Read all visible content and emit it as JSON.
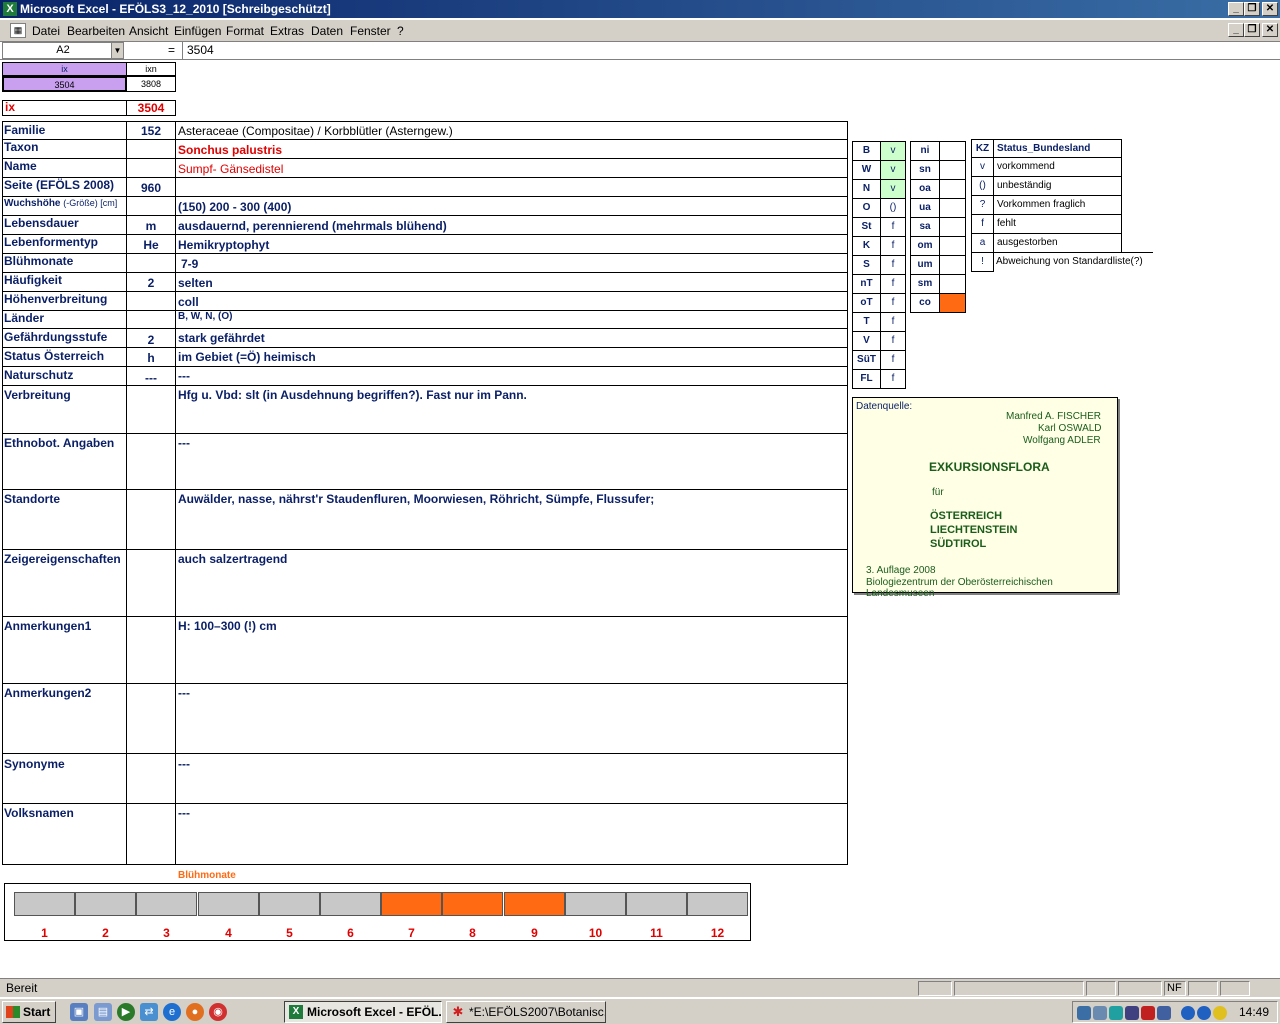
{
  "window": {
    "title": "Microsoft Excel - EFÖLS3_12_2010  [Schreibgeschützt]",
    "app_icon": "excel-icon"
  },
  "menu": [
    "Datei",
    "Bearbeiten",
    "Ansicht",
    "Einfügen",
    "Format",
    "Extras",
    "Daten",
    "Fenster",
    "?"
  ],
  "formula_bar": {
    "name_box": "A2",
    "equals": "=",
    "value": "3504"
  },
  "index_box": {
    "ix_label": "ix",
    "ixn_label": "ixn",
    "ix_value": "3504",
    "ixn_value": "3808"
  },
  "ix_row": {
    "label": "ix",
    "value": "3504"
  },
  "rows": [
    {
      "label": "Familie",
      "num": "152",
      "value": "Asteraceae (Compositae)  /  Korbblütler (Asterngew.)"
    },
    {
      "label": "Taxon",
      "num": "",
      "value": "Sonchus palustris"
    },
    {
      "label": "Name",
      "num": "",
      "value": "Sumpf- Gänsedistel"
    },
    {
      "label": "Seite (EFÖLS 2008)",
      "num": "960",
      "value": ""
    },
    {
      "label": "Wuchshöhe",
      "label_small": "(-Größe) [cm]",
      "num": "",
      "value": "(150) 200 - 300 (400)"
    },
    {
      "label": "Lebensdauer",
      "num": "m",
      "value": "ausdauernd, perennierend (mehrmals blühend)"
    },
    {
      "label": "Lebenformentyp",
      "num": "He",
      "value": "Hemikryptophyt"
    },
    {
      "label": "Blühmonate",
      "num": "",
      "value": "7-9"
    },
    {
      "label": "Häufigkeit",
      "num": "2",
      "value": "selten"
    },
    {
      "label": "Höhenverbreitung",
      "num": "",
      "value": "coll"
    },
    {
      "label": "Länder",
      "num": "",
      "value": "B, W, N, (O)"
    },
    {
      "label": "Gefährdungsstufe",
      "num": "2",
      "value": "stark gefährdet"
    },
    {
      "label": "Status Österreich",
      "num": "h",
      "value": "im Gebiet (=Ö) heimisch"
    },
    {
      "label": "Naturschutz",
      "num": "---",
      "value": "---"
    },
    {
      "label": "Verbreitung",
      "num": "",
      "value": "Hfg u. Vbd:  slt (in Ausdehnung begriffen?). Fast nur im Pann."
    },
    {
      "label": "Ethnobot. Angaben",
      "num": "",
      "value": "---"
    },
    {
      "label": "Standorte",
      "num": "",
      "value": "Auwälder, nasse, nährst'r Staudenfluren, Moorwiesen, Röhricht, Sümpfe, Flussufer;"
    },
    {
      "label": "Zeigereigenschaften",
      "num": "",
      "value": "auch salzertragend"
    },
    {
      "label": "Anmerkungen1",
      "num": "",
      "value": "H: 100–300 (!) cm"
    },
    {
      "label": "Anmerkungen2",
      "num": "",
      "value": "---"
    },
    {
      "label": "Synonyme",
      "num": "",
      "value": "---"
    },
    {
      "label": "Volksnamen",
      "num": "",
      "value": "---"
    }
  ],
  "laender_grid": [
    {
      "code": "B",
      "status": "v"
    },
    {
      "code": "W",
      "status": "v"
    },
    {
      "code": "N",
      "status": "v"
    },
    {
      "code": "O",
      "status": "()"
    },
    {
      "code": "St",
      "status": "f"
    },
    {
      "code": "K",
      "status": "f"
    },
    {
      "code": "S",
      "status": "f"
    },
    {
      "code": "nT",
      "status": "f"
    },
    {
      "code": "oT",
      "status": "f"
    },
    {
      "code": "T",
      "status": "f"
    },
    {
      "code": "V",
      "status": "f"
    },
    {
      "code": "SüT",
      "status": "f"
    },
    {
      "code": "FL",
      "status": "f"
    }
  ],
  "hoehen_grid": [
    "ni",
    "sn",
    "oa",
    "ua",
    "sa",
    "om",
    "um",
    "sm",
    "co"
  ],
  "hoehen_active": "co",
  "legend": {
    "header_kz": "KZ",
    "header_status": "Status_Bundesland",
    "items": [
      {
        "kz": "v",
        "text": "vorkommend"
      },
      {
        "kz": "()",
        "text": "unbeständig"
      },
      {
        "kz": "?",
        "text": "Vorkommen fraglich"
      },
      {
        "kz": "f",
        "text": "fehlt"
      },
      {
        "kz": "a",
        "text": "ausgestorben"
      },
      {
        "kz": "!",
        "text": "Abweichung von Standardliste(?)"
      }
    ]
  },
  "datenquelle": {
    "title": "Datenquelle:",
    "author1": "Manfred A. FISCHER",
    "author2": "Karl OSWALD",
    "author3": "Wolfgang ADLER",
    "book": "EXKURSIONSFLORA",
    "fuer": "für",
    "country1": "ÖSTERREICH",
    "country2": "LIECHTENSTEIN",
    "country3": "SÜDTIROL",
    "edition": "3. Auflage 2008",
    "publisher": "Biologiezentrum der Oberösterreichischen Landesmuseen"
  },
  "bluehmonate_chart": {
    "title": "Blühmonate",
    "months": [
      "1",
      "2",
      "3",
      "4",
      "5",
      "6",
      "7",
      "8",
      "9",
      "10",
      "11",
      "12"
    ],
    "active": [
      7,
      8,
      9
    ],
    "active_color": "#ff6a13",
    "inactive_color": "#c8c8c8"
  },
  "status_bar": {
    "text": "Bereit",
    "nf": "NF"
  },
  "taskbar": {
    "start": "Start",
    "tasks": [
      "Microsoft Excel - EFÖL...",
      "*E:\\EFÖLS2007\\Botanisc..."
    ],
    "clock": "14:49"
  },
  "colors": {
    "label_color": "#0a1f66",
    "accent_red": "#e00000",
    "index_purple": "#c9a0f0",
    "orange": "#ff6a13"
  }
}
